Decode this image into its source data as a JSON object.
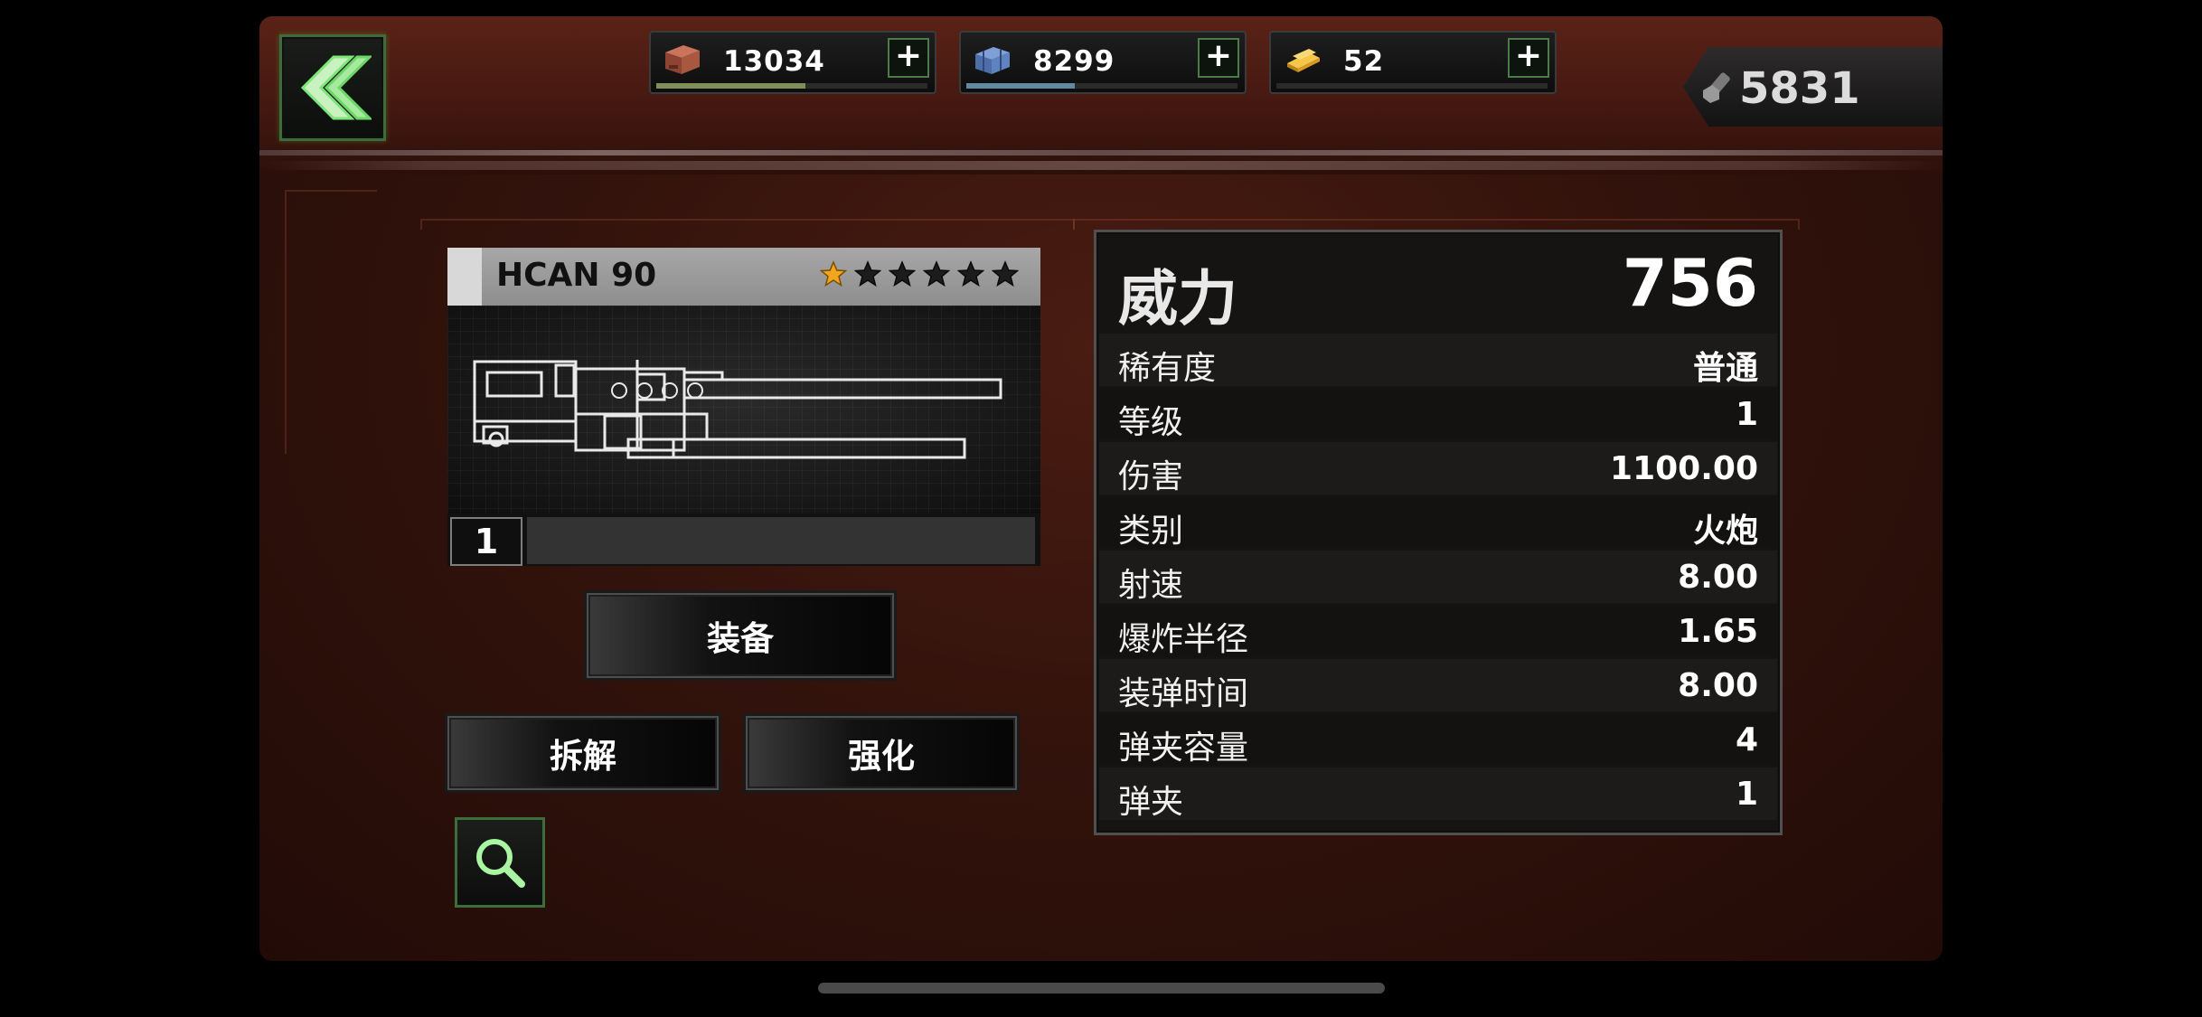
{
  "resources": [
    {
      "value": "13034",
      "icon": "supply-crate-icon",
      "fill": 0.55,
      "color": "#7e8f58"
    },
    {
      "value": "8299",
      "icon": "metal-icon",
      "fill": 0.4,
      "color": "#5f8aa0"
    },
    {
      "value": "52",
      "icon": "gold-bar-icon",
      "fill": 0.0,
      "color": "#c99a2a"
    }
  ],
  "plus_label": "+",
  "gems": {
    "value": "5831",
    "icon": "bolt-icon"
  },
  "weapon": {
    "name": "HCAN 90",
    "stars_filled": 1,
    "stars_total": 6,
    "level": "1"
  },
  "buttons": {
    "equip": "装备",
    "dismantle": "拆解",
    "upgrade": "强化"
  },
  "stats": {
    "header": {
      "label": "威力",
      "value": "756"
    },
    "rows": [
      {
        "label": "稀有度",
        "value": "普通"
      },
      {
        "label": "等级",
        "value": "1"
      },
      {
        "label": "伤害",
        "value": "1100.00"
      },
      {
        "label": "类别",
        "value": "火炮"
      },
      {
        "label": "射速",
        "value": "8.00"
      },
      {
        "label": "爆炸半径",
        "value": "1.65"
      },
      {
        "label": "装弹时间",
        "value": "8.00"
      },
      {
        "label": "弹夹容量",
        "value": "4"
      },
      {
        "label": "弹夹",
        "value": "1"
      }
    ]
  },
  "colors": {
    "accent_green": "#3d6b3c",
    "star_gold": "#f2a51f",
    "background": "#33130c"
  }
}
